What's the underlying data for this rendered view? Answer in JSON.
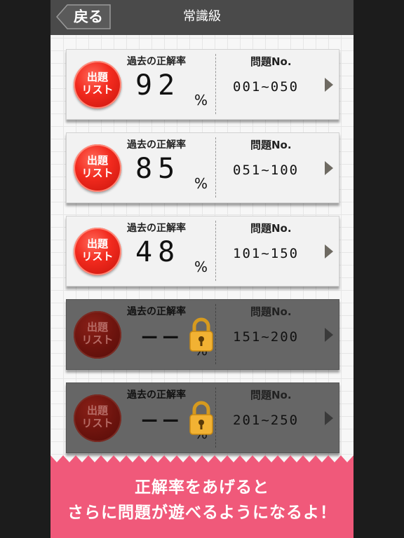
{
  "header": {
    "title": "常識級",
    "back_label": "戻る"
  },
  "rows": [
    {
      "badge_line1": "出題",
      "badge_line2": "リスト",
      "rate_label": "過去の正解率",
      "score": "92",
      "percent": "%",
      "no_label": "問題No.",
      "range": "001~050",
      "locked": false
    },
    {
      "badge_line1": "出題",
      "badge_line2": "リスト",
      "rate_label": "過去の正解率",
      "score": "85",
      "percent": "%",
      "no_label": "問題No.",
      "range": "051~100",
      "locked": false
    },
    {
      "badge_line1": "出題",
      "badge_line2": "リスト",
      "rate_label": "過去の正解率",
      "score": "48",
      "percent": "%",
      "no_label": "問題No.",
      "range": "101~150",
      "locked": false
    },
    {
      "badge_line1": "出題",
      "badge_line2": "リスト",
      "rate_label": "過去の正解率",
      "score": "−−",
      "percent": "%",
      "no_label": "問題No.",
      "range": "151~200",
      "locked": true
    },
    {
      "badge_line1": "出題",
      "badge_line2": "リスト",
      "rate_label": "過去の正解率",
      "score": "−−",
      "percent": "%",
      "no_label": "問題No.",
      "range": "201~250",
      "locked": true
    }
  ],
  "banner": {
    "line1": "正解率をあげると",
    "line2": "さらに問題が遊べるようになるよ！"
  },
  "colors": {
    "header_bg": "#4a4a4a",
    "badge_red": "#f22a1e",
    "banner_pink": "#f0597a",
    "lock_gold": "#f2b233"
  },
  "icons": {
    "back": "back-arrow-tab",
    "lock": "padlock-icon",
    "arrow": "triangle-right-icon"
  }
}
